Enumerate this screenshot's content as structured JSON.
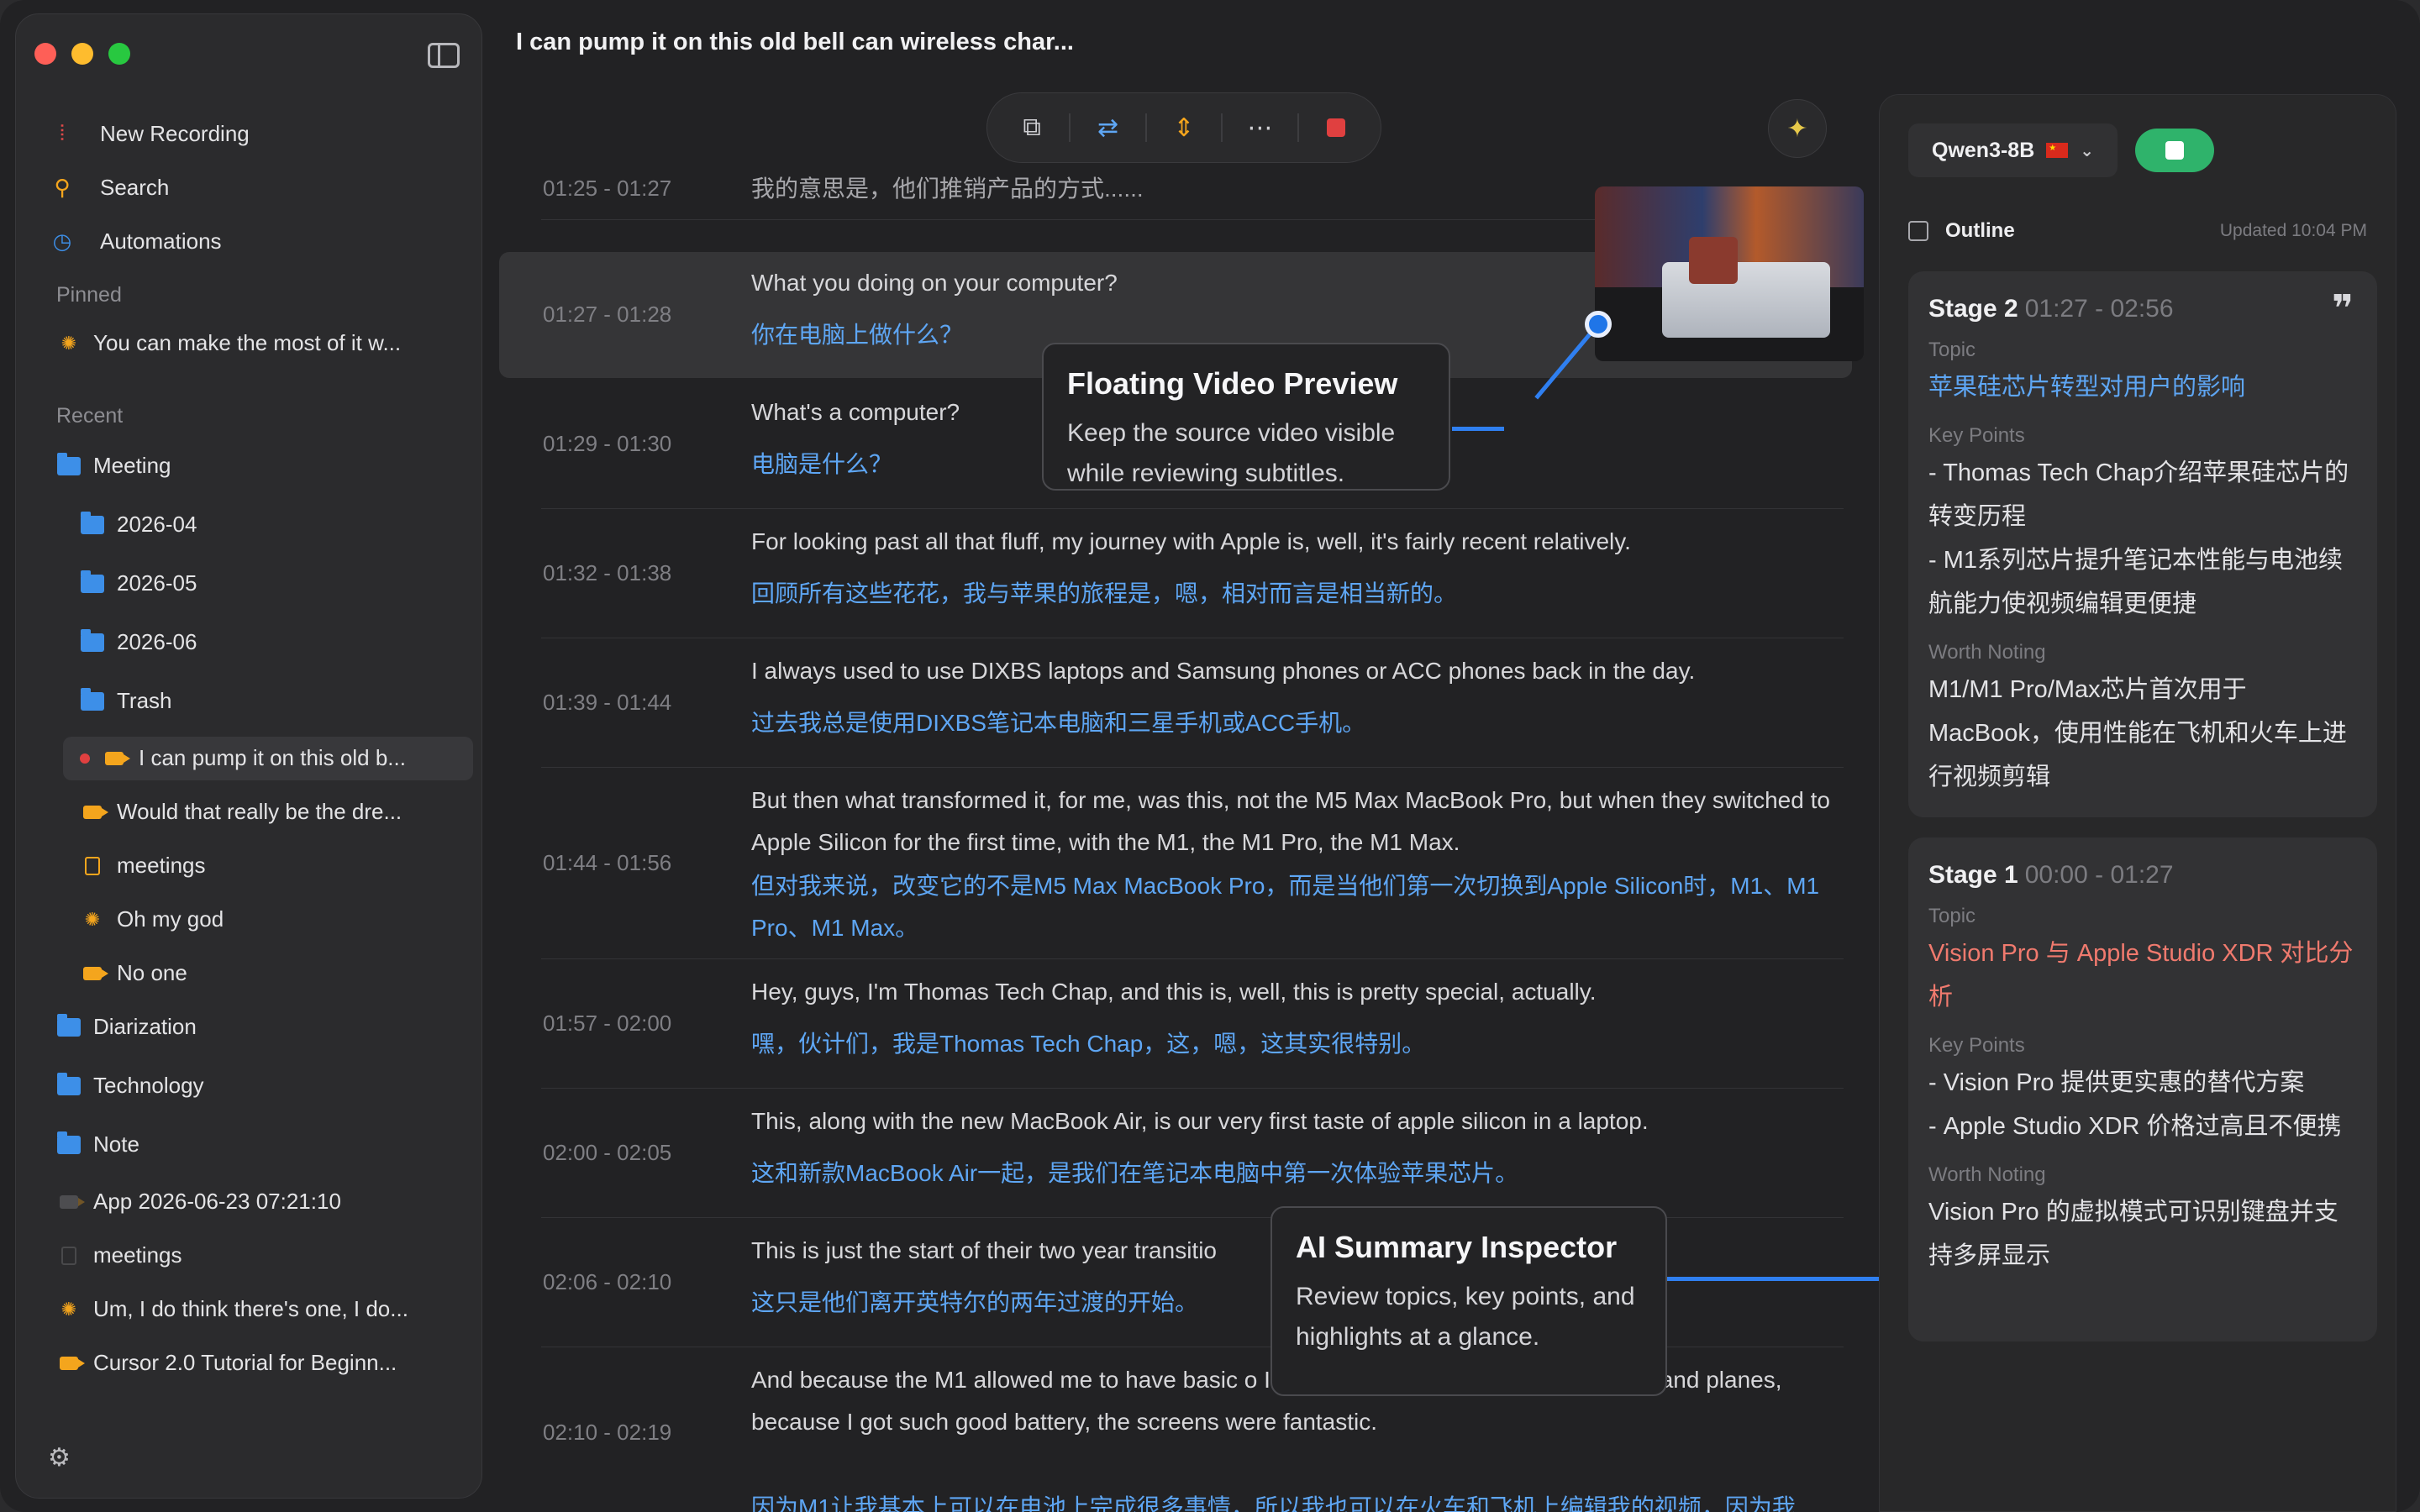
{
  "window": {
    "title": "I can pump it on this old bell can wireless char..."
  },
  "sidebar": {
    "nav": [
      {
        "label": "New Recording",
        "icon": "waveform-icon"
      },
      {
        "label": "Search",
        "icon": "search-icon"
      },
      {
        "label": "Automations",
        "icon": "clock-icon"
      }
    ],
    "pinned_label": "Pinned",
    "pinned": [
      {
        "label": "You can make the most of it w..."
      }
    ],
    "recent_label": "Recent",
    "recent": {
      "meeting": "Meeting",
      "sub_2026_04": "2026-04",
      "sub_2026_05": "2026-05",
      "sub_2026_06": "2026-06",
      "trash": "Trash",
      "current": "I can pump it on this old b...",
      "would": "Would that really be the dre...",
      "meetings1": "meetings",
      "omg": "Oh my god",
      "noone": "No one",
      "diarization": "Diarization",
      "technology": "Technology",
      "note": "Note",
      "app": "App 2026-06-23 07:21:10",
      "meetings2": "meetings",
      "um": "Um, I do think there's one, I do...",
      "cursor": "Cursor 2.0 Tutorial for Beginn..."
    }
  },
  "transcript": {
    "segments": [
      {
        "time": "01:25 - 01:27",
        "en": "",
        "zh": "我的意思是，他们推销产品的方式......"
      },
      {
        "time": "01:27 - 01:28",
        "en": "What you doing on your computer?",
        "zh": "你在电脑上做什么？"
      },
      {
        "time": "01:29 - 01:30",
        "en": "What's a computer?",
        "zh": "电脑是什么？"
      },
      {
        "time": "01:32 - 01:38",
        "en": "For looking past all that fluff, my journey with Apple is, well, it's fairly recent relatively.",
        "zh": "回顾所有这些花花，我与苹果的旅程是，嗯，相对而言是相当新的。"
      },
      {
        "time": "01:39 - 01:44",
        "en": "I always used to use DIXBS laptops and Samsung phones or ACC phones back in the day.",
        "zh": "过去我总是使用DIXBS笔记本电脑和三星手机或ACC手机。"
      },
      {
        "time": "01:44 - 01:56",
        "en": "But then what transformed it, for me, was this, not the M5 Max MacBook Pro, but when they switched to Apple Silicon for the first time, with the M1, the M1 Pro, the M1 Max.",
        "zh": "但对我来说，改变它的不是M5 Max MacBook Pro，而是当他们第一次切换到Apple Silicon时，M1、M1 Pro、M1 Max。"
      },
      {
        "time": "01:57 - 02:00",
        "en": "Hey, guys, I'm Thomas Tech Chap, and this is, well, this is pretty special, actually.",
        "zh": "嘿，伙计们，我是Thomas Tech Chap，这，嗯，这其实很特别。"
      },
      {
        "time": "02:00 - 02:05",
        "en": "This, along with the new MacBook Air, is our very first taste of apple silicon in a laptop.",
        "zh": "这和新款MacBook Air一起，是我们在笔记本电脑中第一次体验苹果芯片。"
      },
      {
        "time": "02:06 - 02:10",
        "en": "This is just the start of their two year transitio",
        "zh": "这只是他们离开英特尔的两年过渡的开始。"
      },
      {
        "time": "02:10 - 02:19",
        "en": "And because the M1 allowed me to have basic                                         o I could edit my video as well on trains and planes, because I got such good battery, the screens were fantastic.",
        "zh": "因为M1让我基本上可以在电池上完成很多事情，所以我也可以在火车和飞机上编辑我的视频，因为我"
      }
    ]
  },
  "callouts": {
    "video": {
      "title": "Floating Video Preview",
      "body": "Keep the source video visible while reviewing subtitles."
    },
    "inspector": {
      "title": "AI Summary Inspector",
      "body": "Review topics, key points, and highlights at a glance."
    }
  },
  "inspector": {
    "model": "Qwen3-8B",
    "outline_label": "Outline",
    "updated": "Updated 10:04 PM",
    "stages": [
      {
        "name": "Stage 2",
        "range": "01:27 - 02:56",
        "topic_label": "Topic",
        "topic": "苹果硅芯片转型对用户的影响",
        "topic_color": "#5ea6f4",
        "keypoints_label": "Key Points",
        "keypoints": "- Thomas Tech Chap介绍苹果硅芯片的转变历程\n- M1系列芯片提升笔记本性能与电池续航能力使视频编辑更便捷",
        "worth_label": "Worth Noting",
        "worth": "M1/M1 Pro/Max芯片首次用于MacBook，使用性能在飞机和火车上进行视频剪辑"
      },
      {
        "name": "Stage 1",
        "range": "00:00 - 01:27",
        "topic_label": "Topic",
        "topic": "Vision Pro 与 Apple Studio XDR 对比分析",
        "topic_color": "#f07a6e",
        "keypoints_label": "Key Points",
        "keypoints": "- Vision Pro 提供更实惠的替代方案\n- Apple Studio XDR 价格过高且不便携",
        "worth_label": "Worth Noting",
        "worth": "Vision Pro 的虚拟模式可识别键盘并支持多屏显示"
      }
    ]
  }
}
